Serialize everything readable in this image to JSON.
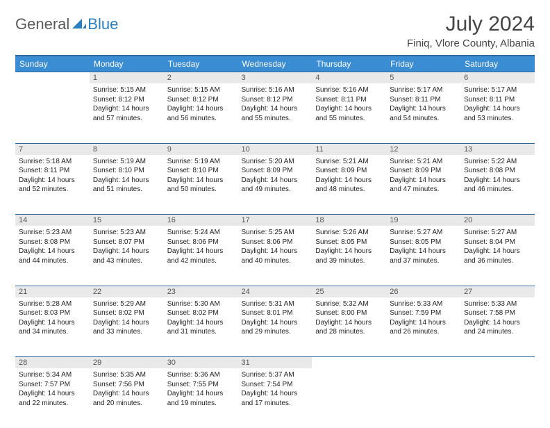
{
  "brand": {
    "part1": "General",
    "part2": "Blue"
  },
  "title": "July 2024",
  "location": "Finiq, Vlore County, Albania",
  "day_headers": [
    "Sunday",
    "Monday",
    "Tuesday",
    "Wednesday",
    "Thursday",
    "Friday",
    "Saturday"
  ],
  "weeks": [
    {
      "nums": [
        "",
        "1",
        "2",
        "3",
        "4",
        "5",
        "6"
      ],
      "cells": [
        {
          "sunrise": "",
          "sunset": "",
          "daylight": ""
        },
        {
          "sunrise": "Sunrise: 5:15 AM",
          "sunset": "Sunset: 8:12 PM",
          "daylight": "Daylight: 14 hours and 57 minutes."
        },
        {
          "sunrise": "Sunrise: 5:15 AM",
          "sunset": "Sunset: 8:12 PM",
          "daylight": "Daylight: 14 hours and 56 minutes."
        },
        {
          "sunrise": "Sunrise: 5:16 AM",
          "sunset": "Sunset: 8:12 PM",
          "daylight": "Daylight: 14 hours and 55 minutes."
        },
        {
          "sunrise": "Sunrise: 5:16 AM",
          "sunset": "Sunset: 8:11 PM",
          "daylight": "Daylight: 14 hours and 55 minutes."
        },
        {
          "sunrise": "Sunrise: 5:17 AM",
          "sunset": "Sunset: 8:11 PM",
          "daylight": "Daylight: 14 hours and 54 minutes."
        },
        {
          "sunrise": "Sunrise: 5:17 AM",
          "sunset": "Sunset: 8:11 PM",
          "daylight": "Daylight: 14 hours and 53 minutes."
        }
      ]
    },
    {
      "nums": [
        "7",
        "8",
        "9",
        "10",
        "11",
        "12",
        "13"
      ],
      "cells": [
        {
          "sunrise": "Sunrise: 5:18 AM",
          "sunset": "Sunset: 8:11 PM",
          "daylight": "Daylight: 14 hours and 52 minutes."
        },
        {
          "sunrise": "Sunrise: 5:19 AM",
          "sunset": "Sunset: 8:10 PM",
          "daylight": "Daylight: 14 hours and 51 minutes."
        },
        {
          "sunrise": "Sunrise: 5:19 AM",
          "sunset": "Sunset: 8:10 PM",
          "daylight": "Daylight: 14 hours and 50 minutes."
        },
        {
          "sunrise": "Sunrise: 5:20 AM",
          "sunset": "Sunset: 8:09 PM",
          "daylight": "Daylight: 14 hours and 49 minutes."
        },
        {
          "sunrise": "Sunrise: 5:21 AM",
          "sunset": "Sunset: 8:09 PM",
          "daylight": "Daylight: 14 hours and 48 minutes."
        },
        {
          "sunrise": "Sunrise: 5:21 AM",
          "sunset": "Sunset: 8:09 PM",
          "daylight": "Daylight: 14 hours and 47 minutes."
        },
        {
          "sunrise": "Sunrise: 5:22 AM",
          "sunset": "Sunset: 8:08 PM",
          "daylight": "Daylight: 14 hours and 46 minutes."
        }
      ]
    },
    {
      "nums": [
        "14",
        "15",
        "16",
        "17",
        "18",
        "19",
        "20"
      ],
      "cells": [
        {
          "sunrise": "Sunrise: 5:23 AM",
          "sunset": "Sunset: 8:08 PM",
          "daylight": "Daylight: 14 hours and 44 minutes."
        },
        {
          "sunrise": "Sunrise: 5:23 AM",
          "sunset": "Sunset: 8:07 PM",
          "daylight": "Daylight: 14 hours and 43 minutes."
        },
        {
          "sunrise": "Sunrise: 5:24 AM",
          "sunset": "Sunset: 8:06 PM",
          "daylight": "Daylight: 14 hours and 42 minutes."
        },
        {
          "sunrise": "Sunrise: 5:25 AM",
          "sunset": "Sunset: 8:06 PM",
          "daylight": "Daylight: 14 hours and 40 minutes."
        },
        {
          "sunrise": "Sunrise: 5:26 AM",
          "sunset": "Sunset: 8:05 PM",
          "daylight": "Daylight: 14 hours and 39 minutes."
        },
        {
          "sunrise": "Sunrise: 5:27 AM",
          "sunset": "Sunset: 8:05 PM",
          "daylight": "Daylight: 14 hours and 37 minutes."
        },
        {
          "sunrise": "Sunrise: 5:27 AM",
          "sunset": "Sunset: 8:04 PM",
          "daylight": "Daylight: 14 hours and 36 minutes."
        }
      ]
    },
    {
      "nums": [
        "21",
        "22",
        "23",
        "24",
        "25",
        "26",
        "27"
      ],
      "cells": [
        {
          "sunrise": "Sunrise: 5:28 AM",
          "sunset": "Sunset: 8:03 PM",
          "daylight": "Daylight: 14 hours and 34 minutes."
        },
        {
          "sunrise": "Sunrise: 5:29 AM",
          "sunset": "Sunset: 8:02 PM",
          "daylight": "Daylight: 14 hours and 33 minutes."
        },
        {
          "sunrise": "Sunrise: 5:30 AM",
          "sunset": "Sunset: 8:02 PM",
          "daylight": "Daylight: 14 hours and 31 minutes."
        },
        {
          "sunrise": "Sunrise: 5:31 AM",
          "sunset": "Sunset: 8:01 PM",
          "daylight": "Daylight: 14 hours and 29 minutes."
        },
        {
          "sunrise": "Sunrise: 5:32 AM",
          "sunset": "Sunset: 8:00 PM",
          "daylight": "Daylight: 14 hours and 28 minutes."
        },
        {
          "sunrise": "Sunrise: 5:33 AM",
          "sunset": "Sunset: 7:59 PM",
          "daylight": "Daylight: 14 hours and 26 minutes."
        },
        {
          "sunrise": "Sunrise: 5:33 AM",
          "sunset": "Sunset: 7:58 PM",
          "daylight": "Daylight: 14 hours and 24 minutes."
        }
      ]
    },
    {
      "nums": [
        "28",
        "29",
        "30",
        "31",
        "",
        "",
        ""
      ],
      "cells": [
        {
          "sunrise": "Sunrise: 5:34 AM",
          "sunset": "Sunset: 7:57 PM",
          "daylight": "Daylight: 14 hours and 22 minutes."
        },
        {
          "sunrise": "Sunrise: 5:35 AM",
          "sunset": "Sunset: 7:56 PM",
          "daylight": "Daylight: 14 hours and 20 minutes."
        },
        {
          "sunrise": "Sunrise: 5:36 AM",
          "sunset": "Sunset: 7:55 PM",
          "daylight": "Daylight: 14 hours and 19 minutes."
        },
        {
          "sunrise": "Sunrise: 5:37 AM",
          "sunset": "Sunset: 7:54 PM",
          "daylight": "Daylight: 14 hours and 17 minutes."
        },
        {
          "sunrise": "",
          "sunset": "",
          "daylight": ""
        },
        {
          "sunrise": "",
          "sunset": "",
          "daylight": ""
        },
        {
          "sunrise": "",
          "sunset": "",
          "daylight": ""
        }
      ]
    }
  ]
}
